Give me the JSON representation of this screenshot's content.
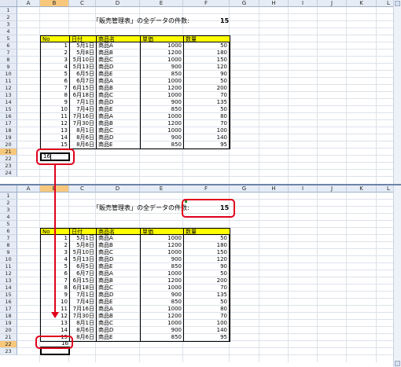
{
  "columns": [
    "A",
    "B",
    "C",
    "D",
    "E",
    "F",
    "G",
    "H",
    "I",
    "J",
    "K",
    "L"
  ],
  "top_pane": {
    "rows": [
      "1",
      "2",
      "3",
      "4",
      "5",
      "6",
      "7",
      "8",
      "9",
      "10",
      "11",
      "12",
      "13",
      "14",
      "15",
      "16",
      "17",
      "18",
      "19",
      "20",
      "21",
      "22",
      "23",
      "24"
    ],
    "title": "「販売管理表」の全データの件数:",
    "count": "15",
    "active_cell_value": "16"
  },
  "bottom_pane": {
    "rows": [
      "1",
      "2",
      "3",
      "4",
      "5",
      "6",
      "7",
      "8",
      "9",
      "10",
      "11",
      "12",
      "13",
      "14",
      "15",
      "16",
      "17",
      "18",
      "19",
      "20",
      "21",
      "22",
      "23"
    ],
    "title": "「販売管理表」の全データの件数:",
    "count": "15",
    "added_row": {
      "no": "16"
    }
  },
  "table": {
    "headers": [
      "No",
      "日付",
      "商品名",
      "単価",
      "数量"
    ],
    "rows": [
      [
        "1",
        "5月1日",
        "商品A",
        "1000",
        "50"
      ],
      [
        "2",
        "5月8日",
        "商品B",
        "1200",
        "180"
      ],
      [
        "3",
        "5月10日",
        "商品C",
        "1000",
        "150"
      ],
      [
        "4",
        "5月13日",
        "商品D",
        "900",
        "120"
      ],
      [
        "5",
        "6月5日",
        "商品E",
        "850",
        "90"
      ],
      [
        "6",
        "6月7日",
        "商品A",
        "1000",
        "50"
      ],
      [
        "7",
        "6月15日",
        "商品B",
        "1200",
        "200"
      ],
      [
        "8",
        "6月18日",
        "商品C",
        "1000",
        "70"
      ],
      [
        "9",
        "7月1日",
        "商品D",
        "900",
        "135"
      ],
      [
        "10",
        "7月4日",
        "商品E",
        "850",
        "50"
      ],
      [
        "11",
        "7月16日",
        "商品A",
        "1000",
        "80"
      ],
      [
        "12",
        "7月30日",
        "商品B",
        "1200",
        "70"
      ],
      [
        "13",
        "8月1日",
        "商品C",
        "1000",
        "100"
      ],
      [
        "14",
        "8月6日",
        "商品D",
        "900",
        "140"
      ],
      [
        "15",
        "8月6日",
        "商品E",
        "850",
        "95"
      ]
    ]
  },
  "colors": {
    "header_fill": "#ffff00",
    "annotation": "#e0001b",
    "selected_header": "#f7c87c"
  }
}
